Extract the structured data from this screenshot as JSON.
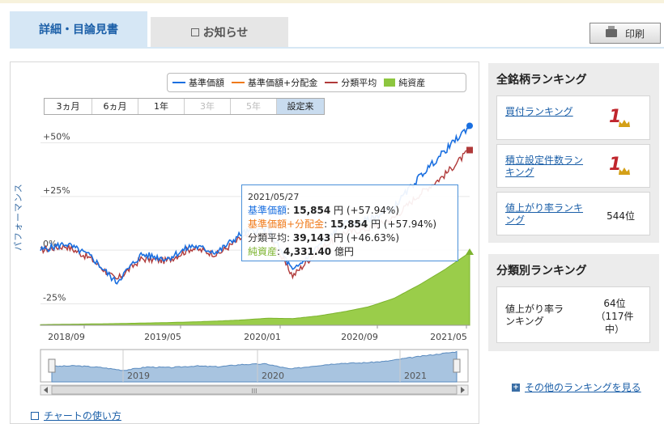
{
  "tabs": {
    "detail": "詳細・目論見書",
    "news": "お知らせ"
  },
  "print_label": "印刷",
  "legend": [
    {
      "label": "基準価額",
      "color": "#1a6fe0",
      "kind": "line"
    },
    {
      "label": "基準価額+分配金",
      "color": "#f07a1a",
      "kind": "line"
    },
    {
      "label": "分類平均",
      "color": "#b03a3a",
      "kind": "line"
    },
    {
      "label": "純資産",
      "color": "#8dc63f",
      "kind": "area"
    }
  ],
  "ranges": [
    {
      "label": "3ヵ月",
      "state": "normal"
    },
    {
      "label": "6ヵ月",
      "state": "normal"
    },
    {
      "label": "1年",
      "state": "normal"
    },
    {
      "label": "3年",
      "state": "disabled"
    },
    {
      "label": "5年",
      "state": "disabled"
    },
    {
      "label": "設定来",
      "state": "active"
    }
  ],
  "yaxis_title": "パフォーマンス",
  "chart_data": {
    "type": "line",
    "y_ticks": [
      "+50%",
      "+25%",
      "0%",
      "-25%"
    ],
    "x_ticks": [
      "2018/09",
      "2019/05",
      "2020/01",
      "2020/09",
      "2021/05"
    ],
    "navigator_ticks": [
      "2019",
      "2020",
      "2021"
    ],
    "navigator_scroll_glyph": "III",
    "x": [
      "2018/07",
      "2018/09",
      "2018/11",
      "2019/01",
      "2019/03",
      "2019/05",
      "2019/07",
      "2019/09",
      "2019/11",
      "2020/01",
      "2020/03",
      "2020/05",
      "2020/07",
      "2020/09",
      "2020/11",
      "2021/01",
      "2021/03",
      "2021/05"
    ],
    "series": [
      {
        "name": "基準価額",
        "color": "#1a6fe0",
        "values": [
          0,
          3,
          -3,
          -15,
          -2,
          -4,
          2,
          -1,
          8,
          10,
          -10,
          2,
          12,
          14,
          20,
          34,
          46,
          57.94
        ]
      },
      {
        "name": "分類平均",
        "color": "#b03a3a",
        "values": [
          0,
          2,
          -4,
          -14,
          -4,
          -5,
          1,
          -2,
          6,
          7,
          -12,
          0,
          8,
          10,
          15,
          26,
          35,
          46.63
        ]
      },
      {
        "name": "純資産",
        "color": "#8dc63f",
        "values": [
          40,
          60,
          80,
          100,
          130,
          160,
          200,
          250,
          320,
          420,
          400,
          560,
          800,
          1100,
          1600,
          2400,
          3300,
          4331.4
        ]
      }
    ],
    "ylim": [
      -35,
      60
    ],
    "tooltip": {
      "date": "2021/05/27",
      "rows": [
        {
          "label": "基準価額",
          "value": "15,854",
          "unit": "円",
          "change": "(+57.94%)",
          "color": "#1a6fe0"
        },
        {
          "label": "基準価額+分配金",
          "value": "15,854",
          "unit": "円",
          "change": "(+57.94%)",
          "color": "#f07a1a"
        },
        {
          "label": "分類平均",
          "value": "39,143",
          "unit": "円",
          "change": "(+46.63%)",
          "color": "#333333"
        },
        {
          "label": "純資産",
          "value": "4,331.40",
          "unit": "億円",
          "change": "",
          "color": "#7cb32e"
        }
      ]
    }
  },
  "howto_link": "チャートの使い方",
  "all_ranking": {
    "title": "全銘柄ランキング",
    "items": [
      {
        "label": "買付ランキング",
        "value": "1",
        "link": true,
        "crown": true
      },
      {
        "label": "積立設定件数ランキング",
        "value": "1",
        "link": true,
        "crown": true
      },
      {
        "label": "値上がり率ランキング",
        "value": "544位",
        "link": true,
        "crown": false
      }
    ]
  },
  "category_ranking": {
    "title": "分類別ランキング",
    "item": {
      "label": "値上がり率ランキング",
      "value": "64位（117件中）"
    }
  },
  "more_link": "その他のランキングを見る"
}
